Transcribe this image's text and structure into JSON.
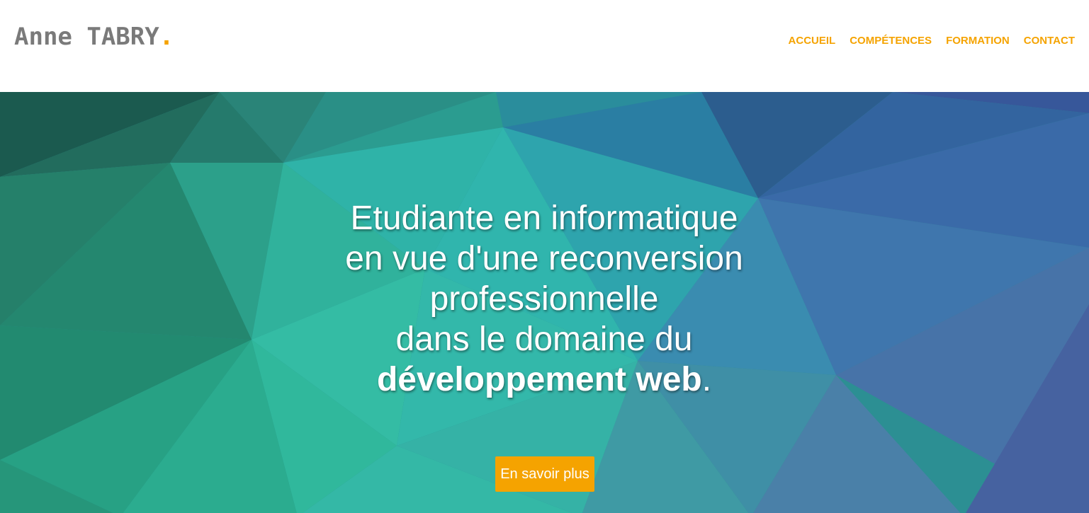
{
  "brand": {
    "name": "Anne TABRY",
    "dot": ".",
    "accent_color": "#f5a300",
    "text_color": "#7a7a7a"
  },
  "nav": {
    "items": [
      {
        "label": "ACCUEIL"
      },
      {
        "label": "COMPÉTENCES"
      },
      {
        "label": "FORMATION"
      },
      {
        "label": "CONTACT"
      }
    ]
  },
  "hero": {
    "lines": [
      "Etudiante en informatique",
      "en vue d'une reconversion",
      "professionnelle",
      "dans le domaine du"
    ],
    "emphasis": "développement web",
    "emphasis_suffix": ".",
    "cta_label": "En savoir plus",
    "background": "low-poly teal-to-blue gradient"
  }
}
